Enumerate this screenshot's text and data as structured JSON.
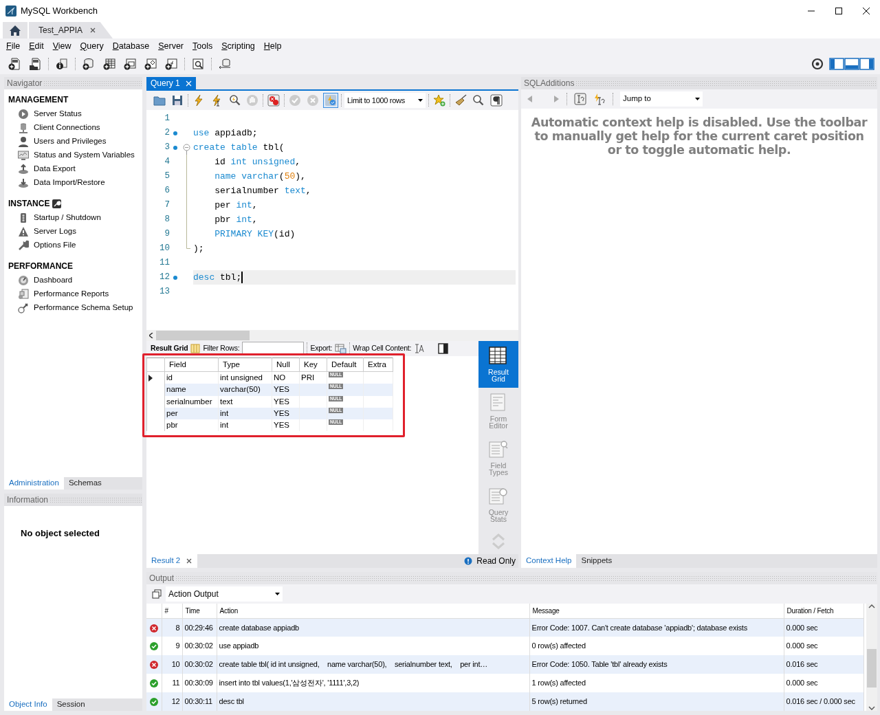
{
  "window": {
    "title": "MySQL Workbench"
  },
  "connection_tabs": [
    {
      "label": "Test_APPIA",
      "selected": true
    }
  ],
  "menu": [
    "File",
    "Edit",
    "View",
    "Query",
    "Database",
    "Server",
    "Tools",
    "Scripting",
    "Help"
  ],
  "navigator": {
    "title": "Navigator",
    "sections": [
      {
        "title": "MANAGEMENT",
        "items": [
          "Server Status",
          "Client Connections",
          "Users and Privileges",
          "Status and System Variables",
          "Data Export",
          "Data Import/Restore"
        ]
      },
      {
        "title": "INSTANCE",
        "items": [
          "Startup / Shutdown",
          "Server Logs",
          "Options File"
        ]
      },
      {
        "title": "PERFORMANCE",
        "items": [
          "Dashboard",
          "Performance Reports",
          "Performance Schema Setup"
        ]
      }
    ],
    "tabs": [
      {
        "label": "Administration",
        "selected": true
      },
      {
        "label": "Schemas",
        "selected": false
      }
    ]
  },
  "information": {
    "title": "Information",
    "message": "No object selected",
    "tabs": [
      {
        "label": "Object Info",
        "selected": true
      },
      {
        "label": "Session",
        "selected": false
      }
    ]
  },
  "query": {
    "tabs": [
      {
        "label": "Query 1",
        "selected": true
      }
    ],
    "autocommit": true,
    "limit": "Limit to 1000 rows",
    "lines": [
      {
        "number": "1",
        "kind": "plain",
        "statement": false,
        "current": false
      },
      {
        "number": "2",
        "kind": "plain",
        "statement": true,
        "current": false,
        "tokens": [
          {
            "kind": "keyword",
            "text": "use"
          },
          {
            "kind": "plain",
            "text": " appiadb;"
          }
        ]
      },
      {
        "number": "3",
        "kind": "foldstart",
        "statement": true,
        "current": false,
        "tokens": [
          {
            "kind": "keyword",
            "text": "create table"
          },
          {
            "kind": "plain",
            "text": " tbl("
          }
        ]
      },
      {
        "number": "4",
        "kind": "foldbody",
        "statement": false,
        "current": false,
        "indented": true,
        "tokens": [
          {
            "kind": "plain",
            "text": "id "
          },
          {
            "kind": "keyword",
            "text": "int unsigned"
          },
          {
            "kind": "plain",
            "text": ","
          }
        ]
      },
      {
        "number": "5",
        "kind": "foldbody",
        "statement": false,
        "current": false,
        "indented": true,
        "tokens": [
          {
            "kind": "keyword",
            "text": "name varchar"
          },
          {
            "kind": "plain",
            "text": "("
          },
          {
            "kind": "number",
            "text": "50"
          },
          {
            "kind": "plain",
            "text": "),"
          }
        ]
      },
      {
        "number": "6",
        "kind": "foldbody",
        "statement": false,
        "current": false,
        "indented": true,
        "tokens": [
          {
            "kind": "plain",
            "text": "serialnumber "
          },
          {
            "kind": "keyword",
            "text": "text"
          },
          {
            "kind": "plain",
            "text": ","
          }
        ]
      },
      {
        "number": "7",
        "kind": "foldbody",
        "statement": false,
        "current": false,
        "indented": true,
        "tokens": [
          {
            "kind": "plain",
            "text": "per "
          },
          {
            "kind": "keyword",
            "text": "int"
          },
          {
            "kind": "plain",
            "text": ","
          }
        ]
      },
      {
        "number": "8",
        "kind": "foldbody",
        "statement": false,
        "current": false,
        "indented": true,
        "tokens": [
          {
            "kind": "plain",
            "text": "pbr "
          },
          {
            "kind": "keyword",
            "text": "int"
          },
          {
            "kind": "plain",
            "text": ","
          }
        ]
      },
      {
        "number": "9",
        "kind": "foldbody",
        "statement": false,
        "current": false,
        "indented": true,
        "tokens": [
          {
            "kind": "keyword",
            "text": "PRIMARY KEY"
          },
          {
            "kind": "plain",
            "text": "(id)"
          }
        ]
      },
      {
        "number": "10",
        "kind": "foldend",
        "statement": false,
        "current": false,
        "tokens": [
          {
            "kind": "plain",
            "text": ");"
          }
        ]
      },
      {
        "number": "11",
        "kind": "plain",
        "statement": false,
        "current": false
      },
      {
        "number": "12",
        "kind": "plain",
        "statement": true,
        "current": true,
        "tokens": [
          {
            "kind": "keyword",
            "text": "desc"
          },
          {
            "kind": "plain",
            "text": " tbl;"
          }
        ]
      },
      {
        "number": "13",
        "kind": "plain",
        "statement": false,
        "current": false
      }
    ]
  },
  "results": {
    "title": "Result Grid",
    "filter_label": "Filter Rows:",
    "export_label": "Export:",
    "wrap_label": "Wrap Cell Content:",
    "columns": [
      "Field",
      "Type",
      "Null",
      "Key",
      "Default",
      "Extra"
    ],
    "rows": [
      {
        "current": true,
        "cells": [
          {
            "text": "id"
          },
          {
            "text": "int unsigned"
          },
          {
            "text": "NO"
          },
          {
            "text": "PRI"
          },
          {
            "kind": "null",
            "text": "NULL"
          },
          {}
        ]
      },
      {
        "current": false,
        "cells": [
          {
            "text": "name"
          },
          {
            "text": "varchar(50)"
          },
          {
            "text": "YES"
          },
          {},
          {
            "kind": "null",
            "text": "NULL"
          },
          {}
        ]
      },
      {
        "current": false,
        "cells": [
          {
            "text": "serialnumber"
          },
          {
            "text": "text"
          },
          {
            "text": "YES"
          },
          {},
          {
            "kind": "null",
            "text": "NULL"
          },
          {}
        ]
      },
      {
        "current": false,
        "cells": [
          {
            "text": "per"
          },
          {
            "text": "int"
          },
          {
            "text": "YES"
          },
          {},
          {
            "kind": "null",
            "text": "NULL"
          },
          {}
        ]
      },
      {
        "current": false,
        "cells": [
          {
            "text": "pbr"
          },
          {
            "text": "int"
          },
          {
            "text": "YES"
          },
          {},
          {
            "kind": "null",
            "text": "NULL"
          },
          {}
        ]
      }
    ],
    "side_tabs": [
      {
        "label": "Result Grid",
        "selected": true
      },
      {
        "label": "Form Editor",
        "selected": false
      },
      {
        "label": "Field Types",
        "selected": false
      },
      {
        "label": "Query Stats",
        "selected": false
      }
    ],
    "tabs": [
      {
        "label": "Result 2",
        "selected": true
      }
    ],
    "status": "Read Only"
  },
  "sql_additions": {
    "title": "SQLAdditions",
    "jump_to": "Jump to",
    "help_text": "Automatic context help is disabled. Use the toolbar to manually get help for the current caret position or to toggle automatic help.",
    "tabs": [
      {
        "label": "Context Help",
        "selected": true
      },
      {
        "label": "Snippets",
        "selected": false
      }
    ]
  },
  "output": {
    "title": "Output",
    "mode": "Action Output",
    "columns": [
      "#",
      "Time",
      "Action",
      "Message",
      "Duration / Fetch"
    ],
    "rows": [
      {
        "kind": "error",
        "number": "8",
        "time": "00:29:46",
        "action": "create database appiadb",
        "message": "Error Code: 1007. Can't create database 'appiadb'; database exists",
        "duration": "0.000 sec"
      },
      {
        "kind": "ok",
        "number": "9",
        "time": "00:30:02",
        "action": "use appiadb",
        "message": "0 row(s) affected",
        "duration": "0.000 sec"
      },
      {
        "kind": "error",
        "number": "10",
        "time": "00:30:02",
        "action": "create table tbl( id int unsigned,    name varchar(50),    serialnumber text,    per int…",
        "message": "Error Code: 1050. Table 'tbl' already exists",
        "duration": "0.016 sec"
      },
      {
        "kind": "ok",
        "number": "11",
        "time": "00:30:09",
        "action": "insert into tbl values(1,'삼성전자', '1111',3,2)",
        "message": "1 row(s) affected",
        "duration": "0.000 sec"
      },
      {
        "kind": "ok",
        "number": "12",
        "time": "00:30:11",
        "action": "desc tbl",
        "message": "5 row(s) returned",
        "duration": "0.016 sec / 0.000 sec"
      }
    ]
  }
}
